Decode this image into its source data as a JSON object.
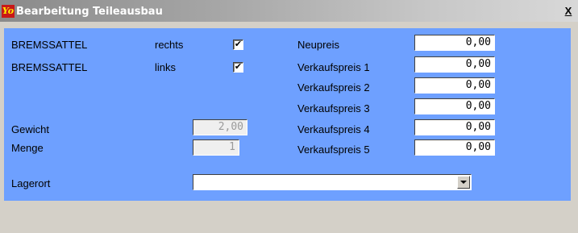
{
  "window": {
    "title": "Bearbeitung Teileausbau",
    "logo_text": "Yo",
    "close_label": "X",
    "colors": {
      "form_background": "#6ea0ff",
      "window_background": "#d4d0c8"
    }
  },
  "parts": [
    {
      "name": "BREMSSATTEL",
      "side": "rechts",
      "checked": true
    },
    {
      "name": "BREMSSATTEL",
      "side": "links",
      "checked": true
    }
  ],
  "check_mark": "✔",
  "weight": {
    "label": "Gewicht",
    "value": "2,00"
  },
  "quantity": {
    "label": "Menge",
    "value": "1"
  },
  "prices": [
    {
      "label": "Neupreis",
      "value": "0,00"
    },
    {
      "label": "Verkaufspreis 1",
      "value": "0,00"
    },
    {
      "label": "Verkaufspreis 2",
      "value": "0,00"
    },
    {
      "label": "Verkaufspreis 3",
      "value": "0,00"
    },
    {
      "label": "Verkaufspreis 4",
      "value": "0,00"
    },
    {
      "label": "Verkaufspreis 5",
      "value": "0,00"
    }
  ],
  "storage": {
    "label": "Lagerort",
    "value": ""
  }
}
